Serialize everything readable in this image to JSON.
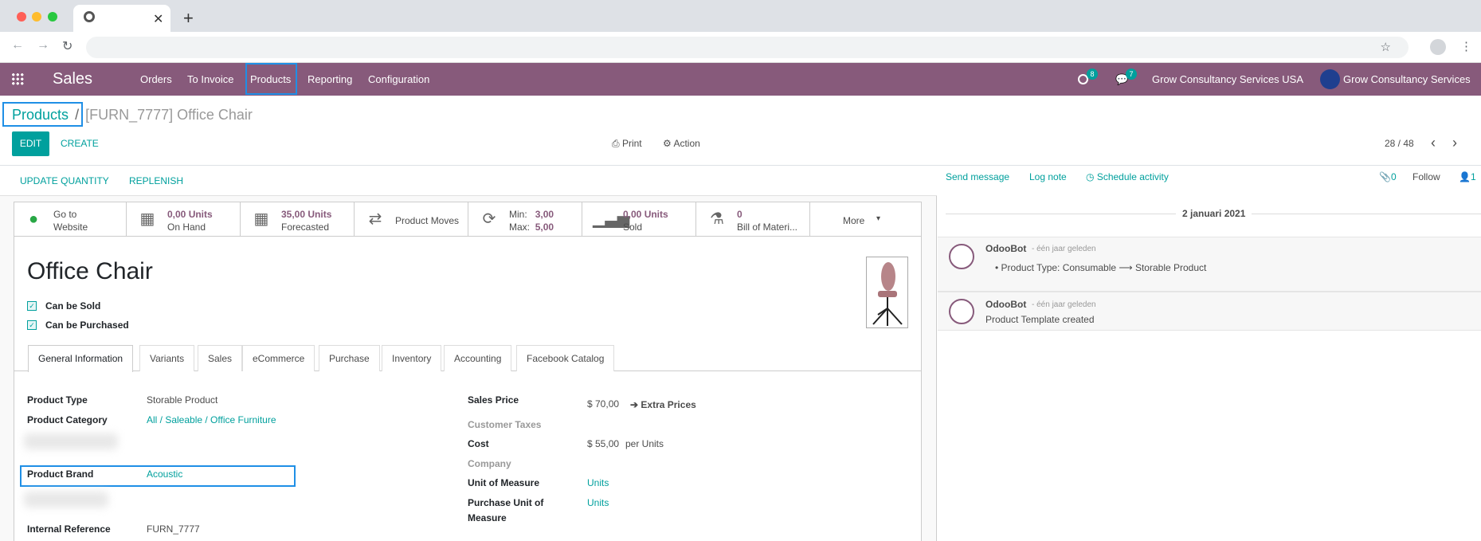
{
  "browser": {
    "tab_title": "",
    "url": ""
  },
  "navbar": {
    "app_name": "Sales",
    "menu": [
      "Orders",
      "To Invoice",
      "Products",
      "Reporting",
      "Configuration"
    ],
    "activity_count": "8",
    "message_count": "7",
    "company": "Grow Consultancy Services USA",
    "user": "Grow Consultancy Services"
  },
  "breadcrumb": {
    "parent": "Products",
    "separator": "/",
    "current": "[FURN_7777] Office Chair"
  },
  "control": {
    "edit": "EDIT",
    "create": "CREATE",
    "print": "Print",
    "action": "Action",
    "pager": "28 / 48"
  },
  "status_buttons": {
    "update_qty": "UPDATE QUANTITY",
    "replenish": "REPLENISH"
  },
  "smart_buttons": [
    {
      "icon": "globe-icon",
      "line1": "Go to",
      "line2": "Website"
    },
    {
      "icon": "cubes-icon",
      "line1": "0,00 Units",
      "line2": "On Hand"
    },
    {
      "icon": "cubes-icon",
      "line1": "35,00 Units",
      "line2": "Forecasted"
    },
    {
      "icon": "exchange-icon",
      "line1": "Product Moves",
      "line2": ""
    },
    {
      "icon": "refresh-icon",
      "min_label": "Min:",
      "min_value": "3,00",
      "max_label": "Max:",
      "max_value": "5,00"
    },
    {
      "icon": "signal-icon",
      "line1": "0,00 Units",
      "line2": "Sold"
    },
    {
      "icon": "flask-icon",
      "line1": "0",
      "line2": "Bill of Materi..."
    },
    {
      "icon": "caret-down-icon",
      "line1": "More",
      "line2": ""
    }
  ],
  "product": {
    "name": "Office Chair",
    "can_be_sold": "Can be Sold",
    "can_be_purchased": "Can be Purchased"
  },
  "tabs": [
    "General Information",
    "Variants",
    "Sales",
    "eCommerce",
    "Purchase",
    "Inventory",
    "Accounting",
    "Facebook Catalog"
  ],
  "general": {
    "left": [
      {
        "label": "Product Type",
        "value": "Storable Product"
      },
      {
        "label": "Product Category",
        "value": "All / Saleable / Office Furniture"
      },
      {
        "label": "Product Brand",
        "value": "Acoustic"
      },
      {
        "label": "Internal Reference",
        "value": "FURN_7777"
      }
    ],
    "right": {
      "sales_price_label": "Sales Price",
      "sales_price": "$ 70,00",
      "extra_prices": "Extra Prices",
      "customer_taxes_label": "Customer Taxes",
      "cost_label": "Cost",
      "cost": "$ 55,00",
      "cost_unit": "per Units",
      "company_label": "Company",
      "uom_label": "Unit of Measure",
      "uom": "Units",
      "purchase_uom_label_1": "Purchase Unit of",
      "purchase_uom_label_2": "Measure",
      "purchase_uom": "Units"
    }
  },
  "chatter": {
    "send_message": "Send message",
    "log_note": "Log note",
    "schedule": "Schedule activity",
    "attachments": "0",
    "follow": "Follow",
    "followers": "1",
    "date": "2 januari 2021",
    "messages": [
      {
        "author": "OdooBot",
        "when": "- één jaar geleden",
        "text_from": "Product Type: Consumable",
        "arrow": "⟶",
        "text_to": "Storable Product"
      },
      {
        "author": "OdooBot",
        "when": "- één jaar geleden",
        "text": "Product Template created"
      }
    ]
  }
}
